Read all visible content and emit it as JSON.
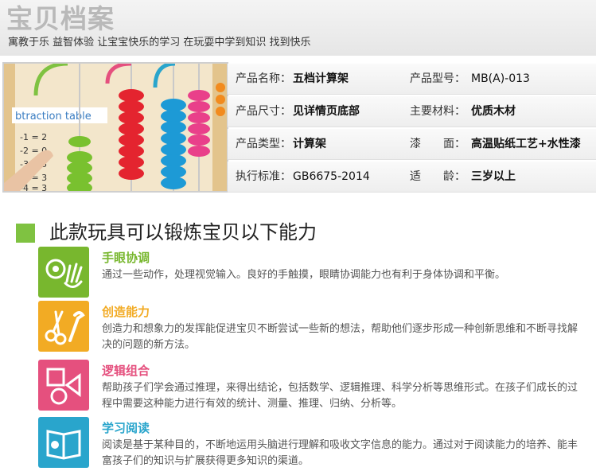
{
  "header": {
    "title": "宝贝档案",
    "subtitle": "寓教于乐 益智体验 让宝宝快乐的学习 在玩耍中学到知识 找到快乐"
  },
  "product_photo": {
    "board_text": "btraction table",
    "board_lines": [
      "-1 = 2",
      "-2 = 0",
      "-3 = 5",
      "-0 = 3",
      "-4 = 3"
    ]
  },
  "specs": [
    {
      "l1": "产品名称：",
      "v1": "五档计算架",
      "l2": "产品型号：",
      "v2": "MB(A)-013"
    },
    {
      "l1": "产品尺寸：",
      "v1": "见详情页底部",
      "l2": "主要材料：",
      "v2": "优质木材"
    },
    {
      "l1": "产品类型：",
      "v1": "计算架",
      "l2": "漆　　面：",
      "v2": "高温贴纸工艺+水性漆"
    },
    {
      "l1": "执行标准：",
      "v1": "GB6675-2014",
      "l2": "适　　龄：",
      "v2": "三岁以上"
    }
  ],
  "abilities_title": "此款玩具可以锻炼宝贝以下能力",
  "abilities": [
    {
      "title": "手眼协调",
      "desc": "通过一些动作，处理视觉输入。良好的手触摸，眼睛协调能力也有利于身体协调和平衡。",
      "color": "#78b72e",
      "icon": "hand-eye-icon"
    },
    {
      "title": "创造能力",
      "desc": "创造力和想象力的发挥能促进宝贝不断尝试一些新的想法，帮助他们逐步形成一种创新思维和不断寻找解决的问题的新方法。",
      "color": "#f2ab24",
      "icon": "scissors-wrench-icon"
    },
    {
      "title": "逻辑组合",
      "desc": "帮助孩子们学会通过推理，来得出结论，包括数学、逻辑推理、科学分析等思维形式。在孩子们成长的过程中需要这种能力进行有效的统计、测量、推理、归纳、分析等。",
      "color": "#e5507e",
      "icon": "shapes-icon"
    },
    {
      "title": "学习阅读",
      "desc": "阅读是基于某种目的，不断地运用头脑进行理解和吸收文字信息的能力。通过对于阅读能力的培养、能丰富孩子们的知识与扩展获得更多知识的渠道。",
      "color": "#29a5cc",
      "icon": "book-icon"
    }
  ]
}
